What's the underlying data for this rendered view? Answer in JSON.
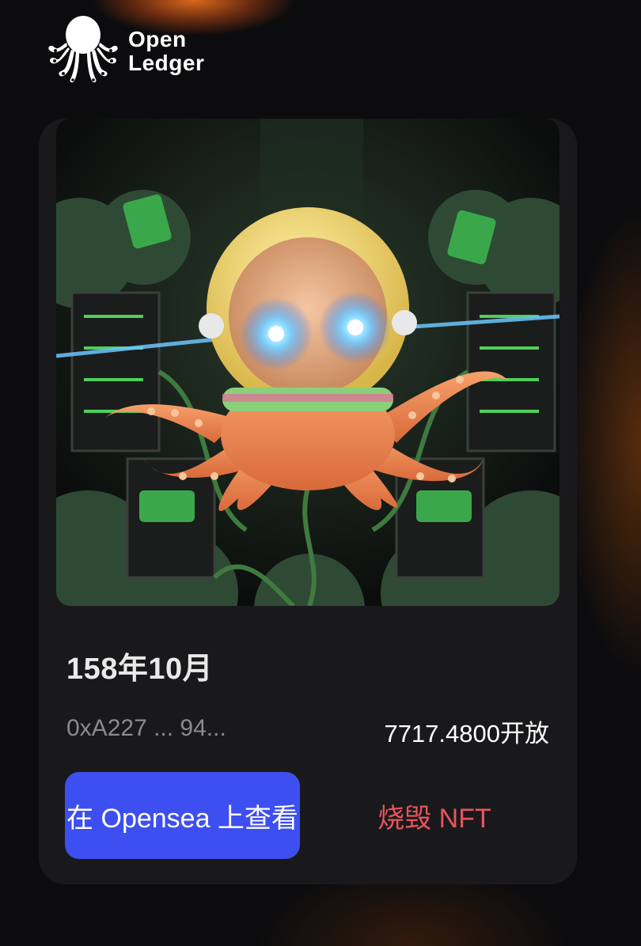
{
  "brand": {
    "name_line1": "Open",
    "name_line2": "Ledger",
    "logo_icon": "octopus-logo-icon"
  },
  "nft": {
    "image_icon": "octopus-astronaut-artwork",
    "title": "158年10月",
    "address": "0xA227 ... 94...",
    "amount": "7717.4800开放"
  },
  "actions": {
    "opensea_label": "在 Opensea 上查看",
    "burn_label": "烧毁 NFT"
  },
  "colors": {
    "background": "#0c0c0e",
    "card": "#19191b",
    "primary_button": "#3d4ff0",
    "burn_text": "#e8555e",
    "accent_glow": "#ff7a1e"
  }
}
